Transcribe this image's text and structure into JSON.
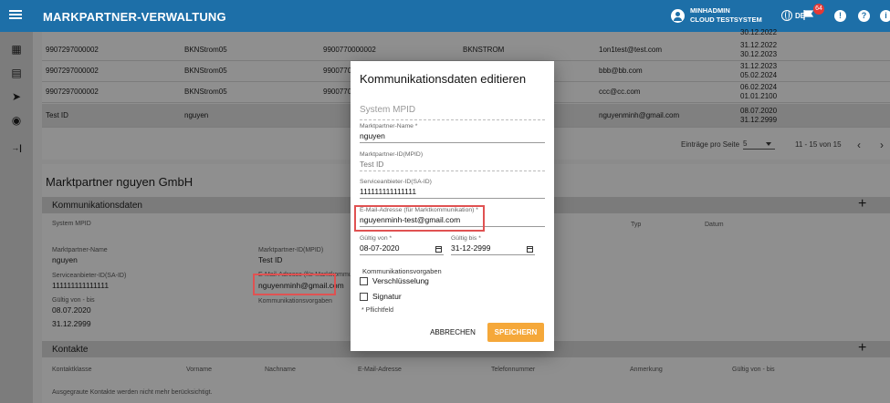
{
  "app": {
    "title": "MARKPARTNER-VERWALTUNG",
    "user_name": "MINHADMIN",
    "user_system": "CLOUD TESTSYSTEM",
    "language": "DE",
    "notification_count": "64",
    "brand_color": "#1d6fa8",
    "accent_color": "#f5a83a"
  },
  "sidebar": {
    "items": [
      {
        "icon": "dashboard-icon",
        "glyph": "▦"
      },
      {
        "icon": "list-icon",
        "glyph": "▤"
      },
      {
        "icon": "send-icon",
        "glyph": "➤"
      },
      {
        "icon": "account-icon",
        "glyph": "◉"
      },
      {
        "icon": "collapse-icon",
        "glyph": "→|"
      }
    ]
  },
  "list": {
    "rows": [
      {
        "mpid": "9907297000002",
        "name": "BKNStrom05",
        "said": "9900770000002",
        "type": "BKNSTROM",
        "email": "1on1test@test.com",
        "from": "31.12.2022",
        "to": "30.12.2023"
      },
      {
        "mpid": "9907297000002",
        "name": "BKNStrom05",
        "said": "99007700",
        "type": "",
        "email": "bbb@bb.com",
        "from": "31.12.2023",
        "to": "05.02.2024"
      },
      {
        "mpid": "9907297000002",
        "name": "BKNStrom05",
        "said": "99007700",
        "type": "",
        "email": "ccc@cc.com",
        "from": "06.02.2024",
        "to": "01.01.2100"
      },
      {
        "mpid": "Test ID",
        "name": "nguyen",
        "said": "",
        "type": "",
        "email": "nguyenminh@gmail.com",
        "from": "08.07.2020",
        "to": "31.12.2999"
      }
    ],
    "top_partial_date": "30.12.2022",
    "rows_per_page_label": "Einträge pro Seite",
    "rows_per_page": "5",
    "range": "11 - 15 von 15",
    "prev": "‹",
    "next": "›"
  },
  "detail": {
    "title": "Marktpartner nguyen GmbH",
    "comm_section": "Kommunikationsdaten",
    "system_mpid_label": "System MPID",
    "type_label": "Typ",
    "date_label": "Datum",
    "name_label": "Marktpartner-Name",
    "name_value": "nguyen",
    "mpid_label": "Marktpartner-ID(MPID)",
    "mpid_value": "Test ID",
    "said_label": "Serviceanbieter-ID(SA-ID)",
    "said_value": "111111111111111",
    "email_label": "E-Mail-Adresse (für Marktkommu",
    "email_value": "nguyenminh@gmail.com",
    "comm_rules_label": "Kommunikationsvorgaben",
    "valid_label": "Gültig von - bis",
    "valid_from": "08.07.2020",
    "valid_to": "31.12.2999",
    "contacts_section": "Kontakte",
    "contacts_columns": [
      "Kontaktklasse",
      "Vorname",
      "Nachname",
      "E-Mail-Adresse",
      "Telefonnummer",
      "Anmerkung",
      "Gültig von - bis"
    ],
    "footer_note": "Ausgegraute Kontakte werden nicht mehr berücksichtigt."
  },
  "dialog": {
    "title": "Kommunikationsdaten editieren",
    "system_mpid_label": "System MPID",
    "name_label": "Marktpartner-Name *",
    "name_value": "nguyen",
    "mpid_label": "Marktpartner-ID(MPID)",
    "mpid_value": "Test ID",
    "said_label": "Serviceanbieter-ID(SA-ID)",
    "said_value": "111111111111111",
    "email_label": "E-Mail-Adresse (für Marktkommunikation) *",
    "email_value": "nguyenminh-test@gmail.com",
    "valid_from_label": "Gültig von *",
    "valid_from_value": "08-07-2020",
    "valid_to_label": "Gültig bis *",
    "valid_to_value": "31-12-2999",
    "comm_rules_label": "Kommunikationsvorgaben",
    "encryption_label": "Verschlüsselung",
    "signature_label": "Signatur",
    "required_note": "* Pflichtfeld",
    "cancel_label": "ABBRECHEN",
    "save_label": "SPEICHERN"
  }
}
